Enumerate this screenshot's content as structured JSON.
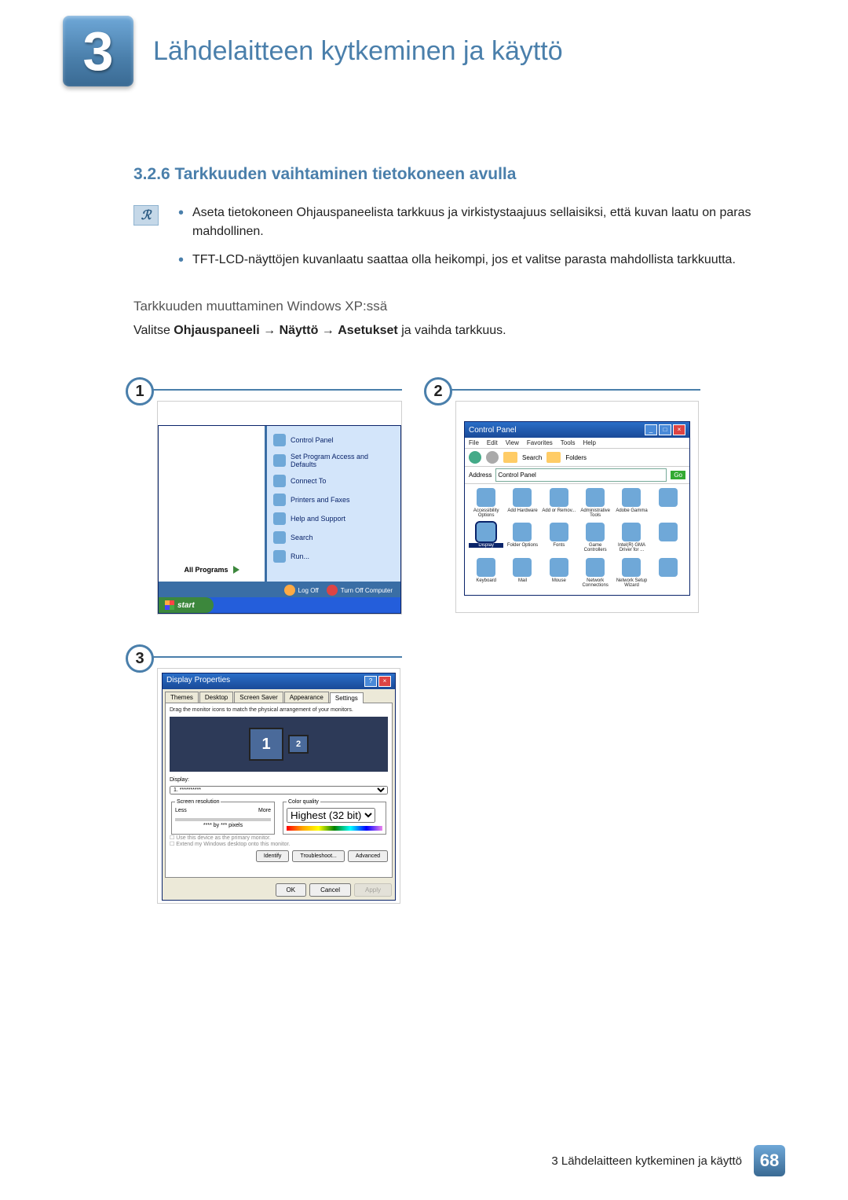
{
  "chapter": {
    "number": "3",
    "title": "Lähdelaitteen kytkeminen ja käyttö"
  },
  "section": {
    "number_and_title": "3.2.6 Tarkkuuden vaihtaminen tietokoneen avulla",
    "bullets": [
      "Aseta tietokoneen Ohjauspaneelista tarkkuus ja virkistystaajuus sellaisiksi, että kuvan laatu on paras mahdollinen.",
      "TFT-LCD-näyttöjen kuvanlaatu saattaa olla heikompi, jos et valitse parasta mahdollista tarkkuutta."
    ],
    "sub_heading": "Tarkkuuden muuttaminen Windows XP:ssä",
    "sub_text_prefix": "Valitse ",
    "sub_text_b1": "Ohjauspaneeli",
    "sub_text_b2": "Näyttö",
    "sub_text_b3": "Asetukset",
    "sub_text_suffix": " ja vaihda tarkkuus.",
    "arrow": "→"
  },
  "figs": {
    "one": "1",
    "two": "2",
    "three": "3"
  },
  "startmenu": {
    "items": [
      "Control Panel",
      "Set Program Access and Defaults",
      "Connect To",
      "Printers and Faxes",
      "Help and Support",
      "Search",
      "Run..."
    ],
    "all_programs": "All Programs",
    "logoff": "Log Off",
    "turnoff": "Turn Off Computer",
    "start": "start"
  },
  "controlpanel": {
    "title": "Control Panel",
    "menu": [
      "File",
      "Edit",
      "View",
      "Favorites",
      "Tools",
      "Help"
    ],
    "toolbar": {
      "search": "Search",
      "folders": "Folders"
    },
    "addr_label": "Address",
    "addr_value": "Control Panel",
    "go": "Go",
    "items": [
      "Accessibility Options",
      "Add Hardware",
      "Add or Remov...",
      "Administrative Tools",
      "Adobe Gamma",
      "",
      "Display",
      "Folder Options",
      "Fonts",
      "Game Controllers",
      "Intel(R) GMA Driver for ...",
      "",
      "Keyboard",
      "Mail",
      "Mouse",
      "Network Connections",
      "Network Setup Wizard",
      ""
    ]
  },
  "display_props": {
    "title": "Display Properties",
    "tabs": [
      "Themes",
      "Desktop",
      "Screen Saver",
      "Appearance",
      "Settings"
    ],
    "hint": "Drag the monitor icons to match the physical arrangement of your monitors.",
    "mon1": "1",
    "mon2": "2",
    "display_label": "Display:",
    "display_value": "1. **********",
    "res_label": "Screen resolution",
    "res_less": "Less",
    "res_more": "More",
    "res_value": "**** by *** pixels",
    "color_label": "Color quality",
    "color_value": "Highest (32 bit)",
    "check1": "Use this device as the primary monitor.",
    "check2": "Extend my Windows desktop onto this monitor.",
    "identify": "Identify",
    "trouble": "Troubleshoot...",
    "advanced": "Advanced",
    "ok": "OK",
    "cancel": "Cancel",
    "apply": "Apply"
  },
  "footer": {
    "text": "3 Lähdelaitteen kytkeminen ja käyttö",
    "page": "68"
  }
}
